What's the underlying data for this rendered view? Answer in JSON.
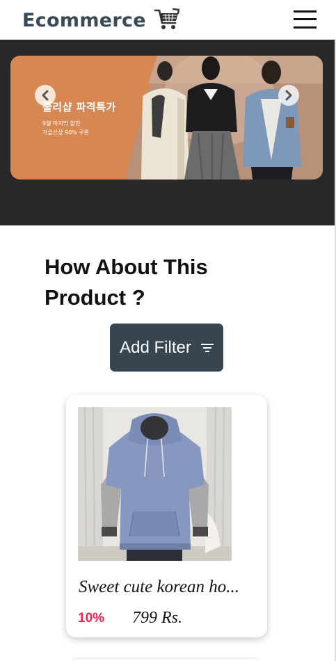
{
  "navbar": {
    "brand": "Ecommerce",
    "brand_icon": "shopping-cart-icon",
    "menu_icon": "hamburger-menu-icon"
  },
  "carousel": {
    "slide_title": "줄리샵 파격특가",
    "slide_subtitle_1": "9월 마지막 할인",
    "slide_subtitle_2": "가을신상 90% 쿠폰",
    "prev_icon": "chevron-left-icon",
    "next_icon": "chevron-right-icon",
    "background_color": "#282828",
    "banner_color": "#d68752"
  },
  "section": {
    "title": "How About This Product ?"
  },
  "filter": {
    "label": "Add Filter",
    "icon": "filter-icon",
    "color": "#36454f"
  },
  "products": [
    {
      "name": "Sweet cute korean ho...",
      "discount": "10%",
      "price": "799 Rs.",
      "discount_color": "#f0244f"
    }
  ]
}
